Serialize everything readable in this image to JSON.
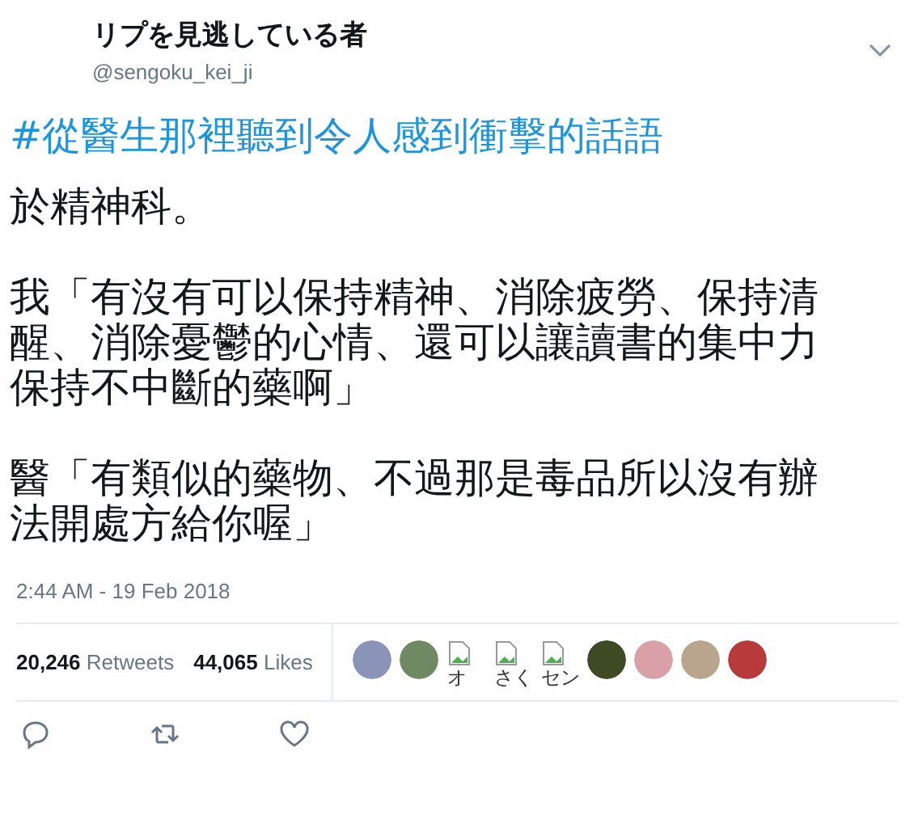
{
  "author": {
    "name": "リプを見逃している者",
    "handle": "@sengoku_kei_ji"
  },
  "hashtag": "#從醫生那裡聽到令人感到衝擊的話語",
  "paragraphs": [
    {
      "lines": [
        "於精神科。"
      ]
    },
    {
      "lines": [
        "我「有沒有可以保持精神、消除疲勞、保持清",
        "醒、消除憂鬱的心情、還可以讓讀書的集中力",
        "保持不中斷的藥啊」"
      ]
    },
    {
      "lines": [
        "醫「有類似的藥物、不過那是毒品所以沒有辦",
        "法開處方給你喔」"
      ]
    }
  ],
  "timestamp": "2:44 AM - 19 Feb 2018",
  "stats": [
    {
      "count": "20,246",
      "label": "Retweets"
    },
    {
      "count": "44,065",
      "label": "Likes"
    }
  ],
  "likers": [
    {
      "kind": "avatar",
      "color": "#8a93b8"
    },
    {
      "kind": "avatar",
      "color": "#6f8a63"
    },
    {
      "kind": "broken",
      "alt": "オ"
    },
    {
      "kind": "broken",
      "alt": "さく"
    },
    {
      "kind": "broken",
      "alt": "セン"
    },
    {
      "kind": "avatar",
      "color": "#3d4a24"
    },
    {
      "kind": "avatar",
      "color": "#d9a0a8"
    },
    {
      "kind": "avatar",
      "color": "#b9a58e"
    },
    {
      "kind": "avatar",
      "color": "#b83a3a"
    }
  ]
}
